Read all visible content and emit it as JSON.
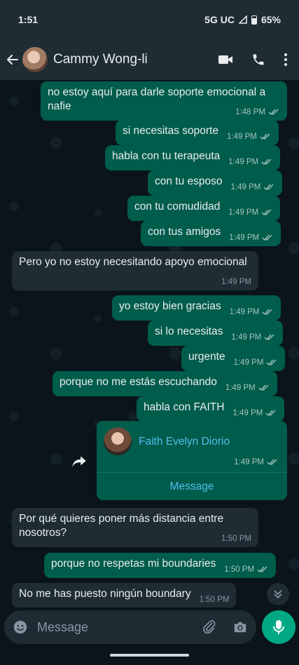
{
  "status_bar": {
    "time": "1:51",
    "network": "5G UC",
    "battery": "65%"
  },
  "header": {
    "contact_name": "Cammy Wong-li"
  },
  "messages": [
    {
      "text": "no estoy aquí para darle soporte emocional a nafie",
      "time": "1:48 PM",
      "direction": "out"
    },
    {
      "text": "si necesitas soporte",
      "time": "1:49 PM",
      "direction": "out"
    },
    {
      "text": "habla con tu terapeuta",
      "time": "1:49 PM",
      "direction": "out"
    },
    {
      "text": "con tu esposo",
      "time": "1:49 PM",
      "direction": "out"
    },
    {
      "text": "con tu comudidad",
      "time": "1:49 PM",
      "direction": "out"
    },
    {
      "text": "con tus amigos",
      "time": "1:49 PM",
      "direction": "out"
    },
    {
      "text": "Pero yo no estoy necesitando apoyo emocional",
      "time": "1:49 PM",
      "direction": "in"
    },
    {
      "text": "yo estoy bien gracias",
      "time": "1:49 PM",
      "direction": "out"
    },
    {
      "text": "si lo necesitas",
      "time": "1:49 PM",
      "direction": "out"
    },
    {
      "text": "urgente",
      "time": "1:49 PM",
      "direction": "out"
    },
    {
      "text": "porque no me estás escuchando",
      "time": "1:49 PM",
      "direction": "out"
    },
    {
      "text": "habla con FAITH",
      "time": "1:49 PM",
      "direction": "out"
    },
    {
      "text": "Por qué quieres poner más distancia entre nosotros?",
      "time": "1:50 PM",
      "direction": "in"
    },
    {
      "text": "porque no respetas mi boundaries",
      "time": "1:50 PM",
      "direction": "out"
    },
    {
      "text": "No me has puesto ningún boundary",
      "time": "1:50 PM",
      "direction": "in"
    }
  ],
  "contact_card": {
    "name": "Faith Evelyn Diorio",
    "time": "1:49 PM",
    "button_label": "Message"
  },
  "input": {
    "placeholder": "Message"
  },
  "colors": {
    "outgoing_bubble": "#005c4b",
    "incoming_bubble": "#1f2c34",
    "background": "#0b141a",
    "accent": "#00a884",
    "link": "#53bdeb"
  }
}
